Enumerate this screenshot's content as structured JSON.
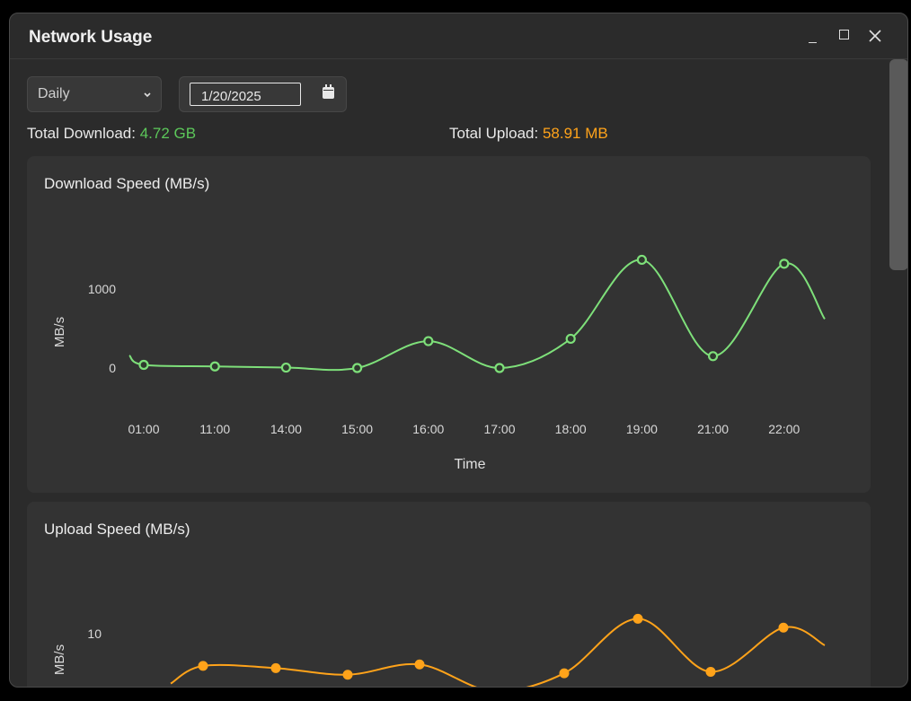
{
  "window": {
    "title": "Network Usage"
  },
  "controls": {
    "period": "Daily",
    "date": "1/20/2025"
  },
  "totals": {
    "download_label": "Total Download:",
    "download_value": "4.72 GB",
    "upload_label": "Total Upload:",
    "upload_value": "58.91 MB"
  },
  "colors": {
    "download": "#7ee07a",
    "download_text": "#5cc85a",
    "upload": "#ffa31a",
    "background": "#2b2b2b",
    "card": "#333333"
  },
  "icons": [
    "minimize-icon",
    "maximize-icon",
    "close-icon",
    "chevron-down-icon",
    "calendar-icon"
  ],
  "chart_data": [
    {
      "type": "line",
      "title": "Download Speed (MB/s)",
      "xlabel": "Time",
      "ylabel": "MB/s",
      "categories": [
        "01:00",
        "11:00",
        "14:00",
        "15:00",
        "16:00",
        "17:00",
        "18:00",
        "19:00",
        "21:00",
        "22:00"
      ],
      "yticks": [
        0,
        1000
      ],
      "series": [
        {
          "values": [
            40,
            20,
            5,
            0,
            340,
            0,
            370,
            1370,
            150,
            1320
          ]
        }
      ]
    },
    {
      "type": "line",
      "title": "Upload Speed (MB/s)",
      "xlabel": "",
      "ylabel": "MB/s",
      "yticks": [
        10
      ],
      "series": [
        {
          "values": [
            5.6,
            5.3,
            4.4,
            5.8,
            null,
            4.6,
            12.0,
            4.8,
            10.8
          ]
        }
      ]
    }
  ]
}
